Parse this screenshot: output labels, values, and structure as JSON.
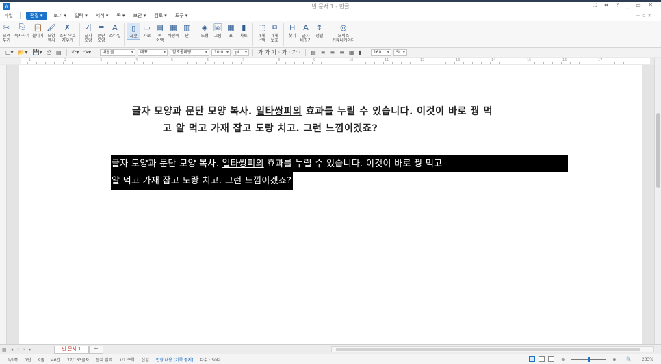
{
  "window": {
    "title": "빈 문서 1 - 한글",
    "controls": "⛶ ⇔ ? _ ▭ ✕"
  },
  "menubar": {
    "file": "파일",
    "items": [
      "편집 ▾",
      "보기 ▾",
      "입력 ▾",
      "서식 ▾",
      "쪽 ▾",
      "보안 ▾",
      "검토 ▾",
      "도구 ▾"
    ],
    "right_label": "ㅡ ㅁ ✕"
  },
  "ribbon": {
    "groups": [
      [
        {
          "icon": "✂",
          "label": "오려\n두기",
          "name": "cut"
        },
        {
          "icon": "⎘",
          "label": "복사하기",
          "name": "copy"
        },
        {
          "icon": "📋",
          "label": "붙이기",
          "name": "paste"
        },
        {
          "icon": "🖌",
          "label": "모양\n복사",
          "name": "format-painter"
        },
        {
          "icon": "✗",
          "label": "조판 부호\n지우기",
          "name": "clear-codes"
        }
      ],
      [
        {
          "icon": "가",
          "label": "글자\n모양",
          "name": "char-shape"
        },
        {
          "icon": "≡",
          "label": "문단\n모양",
          "name": "para-shape"
        },
        {
          "icon": "A",
          "label": "스타일",
          "name": "style"
        }
      ],
      [
        {
          "icon": "▯",
          "label": "세로",
          "name": "portrait",
          "on": true
        },
        {
          "icon": "▭",
          "label": "가로",
          "name": "landscape"
        },
        {
          "icon": "▤",
          "label": "쪽\n여백",
          "name": "page-margin"
        },
        {
          "icon": "▦",
          "label": "바탕쪽",
          "name": "master-page"
        },
        {
          "icon": "▥",
          "label": "단",
          "name": "columns"
        }
      ],
      [
        {
          "icon": "◈",
          "label": "도형",
          "name": "shape"
        },
        {
          "icon": "🖼",
          "label": "그림",
          "name": "picture"
        },
        {
          "icon": "▦",
          "label": "표",
          "name": "table"
        },
        {
          "icon": "▮",
          "label": "차트",
          "name": "chart"
        }
      ],
      [
        {
          "icon": "⬚",
          "label": "개체\n선택",
          "name": "object-select"
        },
        {
          "icon": "⧉",
          "label": "개체\n보호",
          "name": "object-protect"
        }
      ],
      [
        {
          "icon": "H",
          "label": "찾기",
          "name": "find"
        },
        {
          "icon": "A",
          "label": "글자\n바꾸기",
          "name": "replace"
        },
        {
          "icon": "↕",
          "label": "정렬",
          "name": "sort"
        }
      ],
      [
        {
          "icon": "◎",
          "label": "오피스\n커뮤니케이터",
          "name": "office-communicator"
        }
      ]
    ]
  },
  "formatting": {
    "style": "바탕글",
    "lang": "대표",
    "font": "함초롬바탕",
    "size": "10.0",
    "size_unit": "pt",
    "char_buttons": "가 가 가 · 가 · 가 ·",
    "zoom": "160",
    "zoom_unit": "%"
  },
  "ruler": {
    "numbers": [
      "1",
      "2",
      "3",
      "4",
      "5",
      "6",
      "7",
      "8",
      "9",
      "10",
      "11",
      "12",
      "13",
      "14",
      "15",
      "16",
      "17"
    ]
  },
  "document": {
    "para1_line1_a": "글자 모양과 문단 모양 복사. ",
    "para1_line1_u": "일타쌍피의",
    "para1_line1_b": " 효과를 누릴 수 있습니다. 이것이 바로 꿩 먹",
    "para1_line2": "고 알 먹고 가재 잡고 도랑 치고. 그런 느낌이겠죠?",
    "para2_line1_a": "글자 모양과 문단 모양 복사. ",
    "para2_line1_u": "일타쌍피의",
    "para2_line1_b": " 효과를 누릴 수 있습니다. 이것이 바로 꿩 먹고",
    "para2_line2": "알 먹고 가재 잡고 도랑 치고. 그런 느낌이겠죠?"
  },
  "tabs": {
    "doc_tab": "빈 문서 1",
    "add": "+"
  },
  "status": {
    "items": [
      "1/1쪽",
      "1단",
      "9줄",
      "46칸",
      "77/163글자",
      "문자 입력",
      "1/1 구역",
      "삽입"
    ],
    "highlight": "변경 내용 [기록 중지]",
    "typing": "타수 : 50타",
    "zoom": "233%"
  }
}
